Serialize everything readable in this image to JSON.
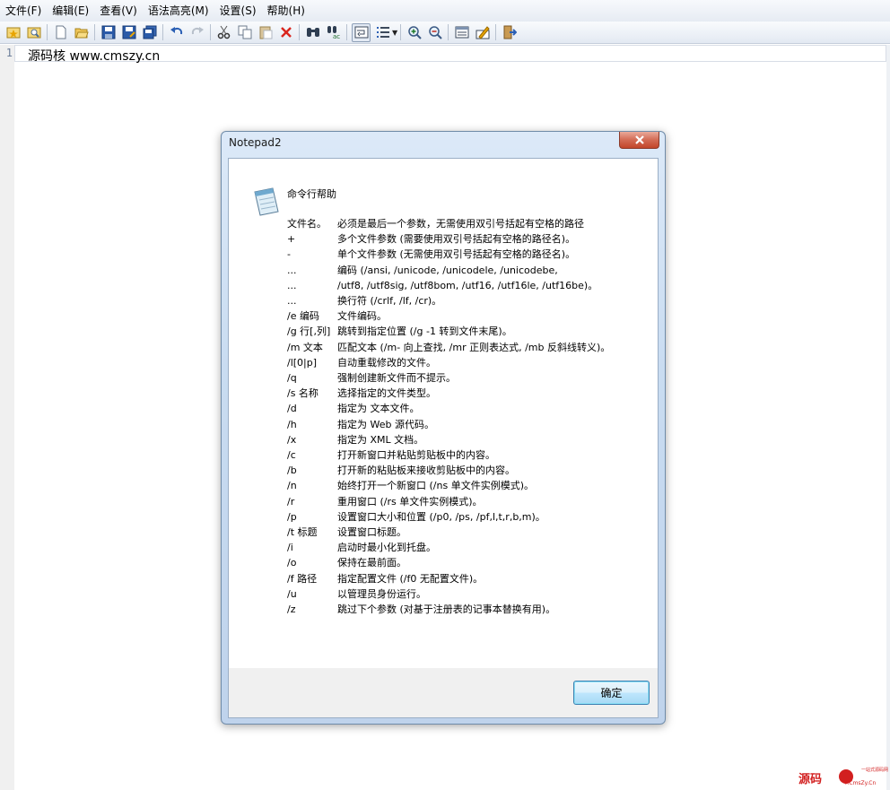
{
  "menu": [
    "文件(F)",
    "编辑(E)",
    "查看(V)",
    "语法高亮(M)",
    "设置(S)",
    "帮助(H)"
  ],
  "toolbar": {
    "groups": [
      [
        "new-window-icon",
        "browse-icon"
      ],
      [
        "new-file-icon",
        "open-file-icon"
      ],
      [
        "save-icon",
        "save-as-icon",
        "save-copy-icon"
      ],
      [
        "undo-icon",
        "redo-icon"
      ],
      [
        "cut-icon",
        "copy-icon",
        "paste-icon",
        "delete-icon"
      ],
      [
        "find-icon",
        "replace-icon"
      ],
      [
        "word-wrap-icon",
        "line-numbers-icon"
      ],
      [
        "zoom-in-icon",
        "zoom-out-icon"
      ],
      [
        "scheme-icon",
        "scheme-config-icon"
      ],
      [
        "exit-icon"
      ]
    ]
  },
  "editor": {
    "line_number": "1",
    "text": "源码核 www.cmszy.cn"
  },
  "dialog": {
    "title": "Notepad2",
    "heading": "命令行帮助",
    "rows": [
      {
        "key": "文件名。",
        "desc": "必须是最后一个参数，无需使用双引号括起有空格的路径"
      },
      {
        "key": "+",
        "desc": "多个文件参数 (需要使用双引号括起有空格的路径名)。"
      },
      {
        "key": "-",
        "desc": "单个文件参数 (无需使用双引号括起有空格的路径名)。"
      },
      {
        "key": "...",
        "desc": "编码 (/ansi, /unicode, /unicodele, /unicodebe,"
      },
      {
        "key": "...",
        "desc": "/utf8, /utf8sig, /utf8bom, /utf16, /utf16le, /utf16be)。"
      },
      {
        "key": "...",
        "desc": "换行符 (/crlf, /lf, /cr)。"
      },
      {
        "key": "/e 编码",
        "desc": "文件编码。"
      },
      {
        "key": "/g 行[,列]",
        "desc": "跳转到指定位置 (/g -1 转到文件末尾)。"
      },
      {
        "key": "/m 文本",
        "desc": "匹配文本 (/m- 向上查找, /mr 正则表达式, /mb 反斜线转义)。"
      },
      {
        "key": "/l[0|p]",
        "desc": "自动重载修改的文件。"
      },
      {
        "key": "/q",
        "desc": "强制创建新文件而不提示。"
      },
      {
        "key": "/s 名称",
        "desc": "选择指定的文件类型。"
      },
      {
        "key": "/d",
        "desc": "指定为 文本文件。"
      },
      {
        "key": "/h",
        "desc": "指定为 Web 源代码。"
      },
      {
        "key": "/x",
        "desc": "指定为 XML 文档。"
      },
      {
        "key": "/c",
        "desc": "打开新窗口并粘贴剪贴板中的内容。"
      },
      {
        "key": "/b",
        "desc": "打开新的粘贴板来接收剪贴板中的内容。"
      },
      {
        "key": "/n",
        "desc": "始终打开一个新窗口 (/ns 单文件实例模式)。"
      },
      {
        "key": "/r",
        "desc": "重用窗口 (/rs 单文件实例模式)。"
      },
      {
        "key": "/p",
        "desc": "设置窗口大小和位置 (/p0, /ps, /pf,l,t,r,b,m)。"
      },
      {
        "key": "/t 标题",
        "desc": "设置窗口标题。"
      },
      {
        "key": "/i",
        "desc": "启动时最小化到托盘。"
      },
      {
        "key": "/o",
        "desc": "保持在最前面。"
      },
      {
        "key": "/f 路径",
        "desc": "指定配置文件 (/f0 无配置文件)。"
      },
      {
        "key": "/u",
        "desc": "以管理员身份运行。"
      },
      {
        "key": "/z",
        "desc": "跳过下个参数 (对基于注册表的记事本替换有用)。"
      }
    ],
    "ok_label": "确定"
  },
  "watermark": {
    "main": "源码",
    "badge": "核",
    "tagline": "一站式源码网",
    "url": "F.CmsZy.Cn"
  },
  "colors": {
    "dialog_frame": "#c9dcf1",
    "close_button": "#c2462a",
    "watermark": "#d21f1f"
  }
}
